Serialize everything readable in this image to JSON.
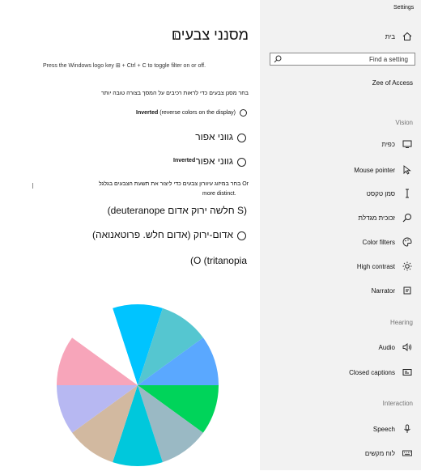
{
  "window": {
    "title": "Settings"
  },
  "sidebar": {
    "home": "בית",
    "search_placeholder": "Find a setting",
    "ease_of_access": "Zee of Access",
    "sections": {
      "vision": "Vision",
      "hearing": "Hearing",
      "interaction": "Interaction"
    },
    "vision_items": [
      {
        "label": "כפית",
        "icon": "display-icon"
      },
      {
        "label": "Mouse pointer",
        "icon": "mouse-pointer-icon"
      },
      {
        "label": "סמן טקסט",
        "icon": "text-cursor-icon"
      },
      {
        "label": "זכוכית מגדלת",
        "icon": "magnifier-icon"
      },
      {
        "label": "Color filters",
        "icon": "palette-icon"
      },
      {
        "label": "High contrast",
        "icon": "brightness-icon"
      },
      {
        "label": "Narrator",
        "icon": "narrator-icon"
      }
    ],
    "hearing_items": [
      {
        "label": "Audio",
        "icon": "speaker-icon"
      },
      {
        "label": "Closed captions",
        "icon": "captions-icon"
      }
    ],
    "interaction_items": [
      {
        "label": "Speech",
        "icon": "microphone-icon"
      },
      {
        "label": "לוח מקשים",
        "icon": "keyboard-icon"
      }
    ]
  },
  "main": {
    "title": "מסנני צבעים",
    "shortcut_hint": "Press the Windows logo key ⊞ + Ctrl + C to toggle filter on or off.",
    "choose_filter_text": "בחר מסנן צבעים כדי לראות רכיבים על המסך בצורה טובה יותר",
    "options": [
      {
        "bold": "Inverted",
        "rest": " (reverse colors on the display)"
      },
      {
        "label": "גווני אפור"
      },
      {
        "label": "גווני אפור",
        "overlay": "Inverted"
      }
    ],
    "blindness_text_line1": "Or בחר במיזוג עיוורון צבעים כדי ליצור את תשעת הצבעים בגלגל",
    "blindness_text_line2": "more distinct.",
    "blindness_options": [
      {
        "label": "(S חלשה ירוק אדום deuteranope)"
      },
      {
        "label": "אדום-ירוק (אדום חלש. פרוטאנואה)"
      },
      {
        "label": "(O (tritanopia"
      }
    ]
  },
  "chart_data": {
    "type": "pie",
    "values": [
      1,
      1,
      1,
      1,
      1,
      1,
      1,
      1,
      1,
      1
    ],
    "colors": [
      "#00c4ff",
      "#55c6d0",
      "#5aa8ff",
      "#00d45a",
      "#9ab9c4",
      "#00c8dc",
      "#d2b9a0",
      "#b7b8f2",
      "#f7a5ba",
      "#ffffff"
    ]
  }
}
